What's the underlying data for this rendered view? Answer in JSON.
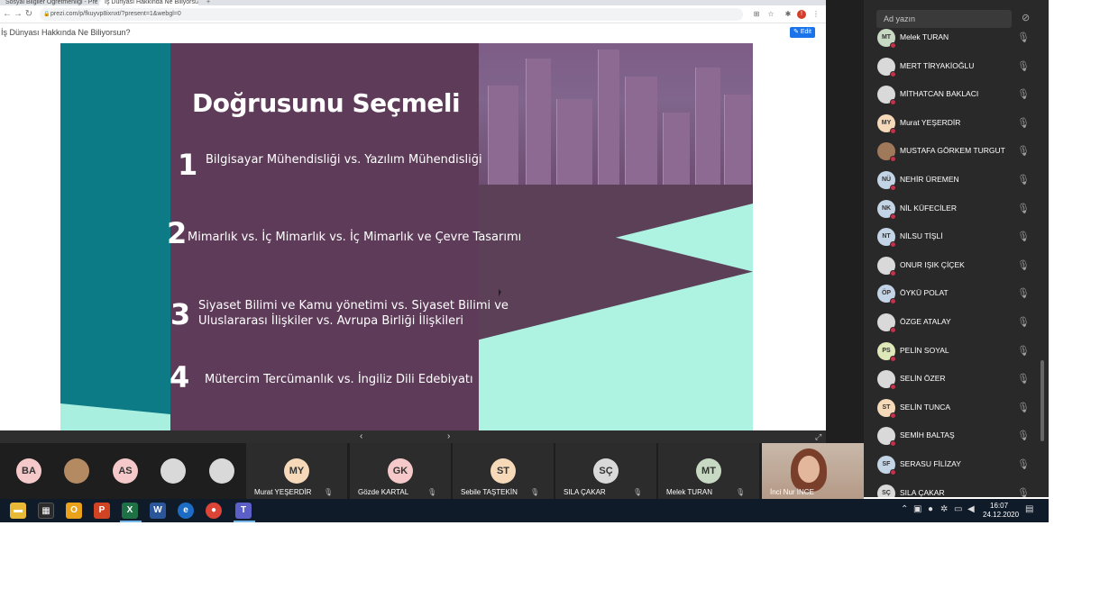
{
  "browser": {
    "tabs": [
      "Sosyal Bilgiler Öğretmenliği - Prezi",
      "İş Dünyası Hakkında Ne Biliyorsun?"
    ],
    "new_tab": "+",
    "url": "prezi.com/p/fkuyvp8ixnxt/?present=1&webgl=0",
    "page_title": "İş Dünyası Hakkında Ne Biliyorsun?",
    "edit_label": "Edit",
    "profile_letter": "!"
  },
  "slide": {
    "title": "Doğrusunu Seçmeli",
    "items": [
      {
        "num": "1",
        "lines": [
          "Bilgisayar Mühendisliği vs. Yazılım Mühendisliği"
        ]
      },
      {
        "num": "2",
        "lines": [
          "Mimarlık vs. İç Mimarlık vs. İç Mimarlık ve Çevre Tasarımı"
        ]
      },
      {
        "num": "3",
        "lines": [
          "Siyaset Bilimi ve Kamu yönetimi vs. Siyaset Bilimi ve",
          "Uluslararası İlişkiler vs. Avrupa Birliği İlişkileri"
        ]
      },
      {
        "num": "4",
        "lines": [
          "Mütercim Tercümanlık vs. İngiliz Dili Edebiyatı"
        ]
      }
    ]
  },
  "controls": {
    "prev": "‹",
    "next": "›",
    "expand": "⤢"
  },
  "panel": {
    "search_placeholder": "Ad yazın",
    "participants": [
      {
        "initials": "MT",
        "name": "Melek TURAN",
        "color": "#c8d9c3"
      },
      {
        "initials": "",
        "name": "MERT TİRYAKİOĞLU",
        "color": "#d9d9d9"
      },
      {
        "initials": "",
        "name": "MİTHATCAN BAKLACI",
        "color": "#d9d9d9"
      },
      {
        "initials": "MY",
        "name": "Murat YEŞERDİR",
        "color": "#f5d9b8"
      },
      {
        "initials": "",
        "name": "MUSTAFA GÖRKEM TURGUT",
        "color": "#a0785a"
      },
      {
        "initials": "NÜ",
        "name": "NEHİR ÜREMEN",
        "color": "#c3d4e6"
      },
      {
        "initials": "NK",
        "name": "NİL KÜFECİLER",
        "color": "#c3d4e6"
      },
      {
        "initials": "NT",
        "name": "NİLSU TİŞLİ",
        "color": "#c3d4e6"
      },
      {
        "initials": "",
        "name": "ONUR IŞIK ÇİÇEK",
        "color": "#d9d9d9"
      },
      {
        "initials": "ÖP",
        "name": "ÖYKÜ POLAT",
        "color": "#c3d4e6"
      },
      {
        "initials": "",
        "name": "ÖZGE ATALAY",
        "color": "#d9d9d9"
      },
      {
        "initials": "PS",
        "name": "PELİN SOYAL",
        "color": "#dfe8b9"
      },
      {
        "initials": "",
        "name": "SELİN ÖZER",
        "color": "#d9d9d9"
      },
      {
        "initials": "ST",
        "name": "SELİN TUNCA",
        "color": "#f5d9b8"
      },
      {
        "initials": "",
        "name": "SEMİH BALTAŞ",
        "color": "#d9d9d9"
      },
      {
        "initials": "SF",
        "name": "SERASU FİLİZAY",
        "color": "#c3d4e6"
      },
      {
        "initials": "SÇ",
        "name": "SILA ÇAKAR",
        "color": "#d9d9d9"
      }
    ]
  },
  "video_strip": {
    "small": [
      {
        "initials": "BA",
        "color": "#f5c9c9"
      },
      {
        "initials": "",
        "color": "#b48a63"
      },
      {
        "initials": "AS",
        "color": "#f5c9c9"
      },
      {
        "initials": "",
        "color": "#d9d9d9"
      },
      {
        "initials": "",
        "color": "#d9d9d9"
      }
    ],
    "tiles": [
      {
        "initials": "MY",
        "name": "Murat YEŞERDİR",
        "color": "#f5d9b8"
      },
      {
        "initials": "GK",
        "name": "Gözde KARTAL",
        "color": "#f5c9c9"
      },
      {
        "initials": "ST",
        "name": "Sebile TAŞTEKİN",
        "color": "#f5d9b8"
      },
      {
        "initials": "SÇ",
        "name": "SILA ÇAKAR",
        "color": "#d9d9d9"
      },
      {
        "initials": "MT",
        "name": "Melek TURAN",
        "color": "#c8d9c3"
      }
    ],
    "video_name": "İnci Nur İNCE"
  },
  "taskbar": {
    "time": "16:07",
    "date": "24.12.2020",
    "apps": [
      "file-explorer",
      "store",
      "outlook",
      "powerpoint",
      "excel",
      "word",
      "edge",
      "chrome",
      "teams"
    ]
  }
}
